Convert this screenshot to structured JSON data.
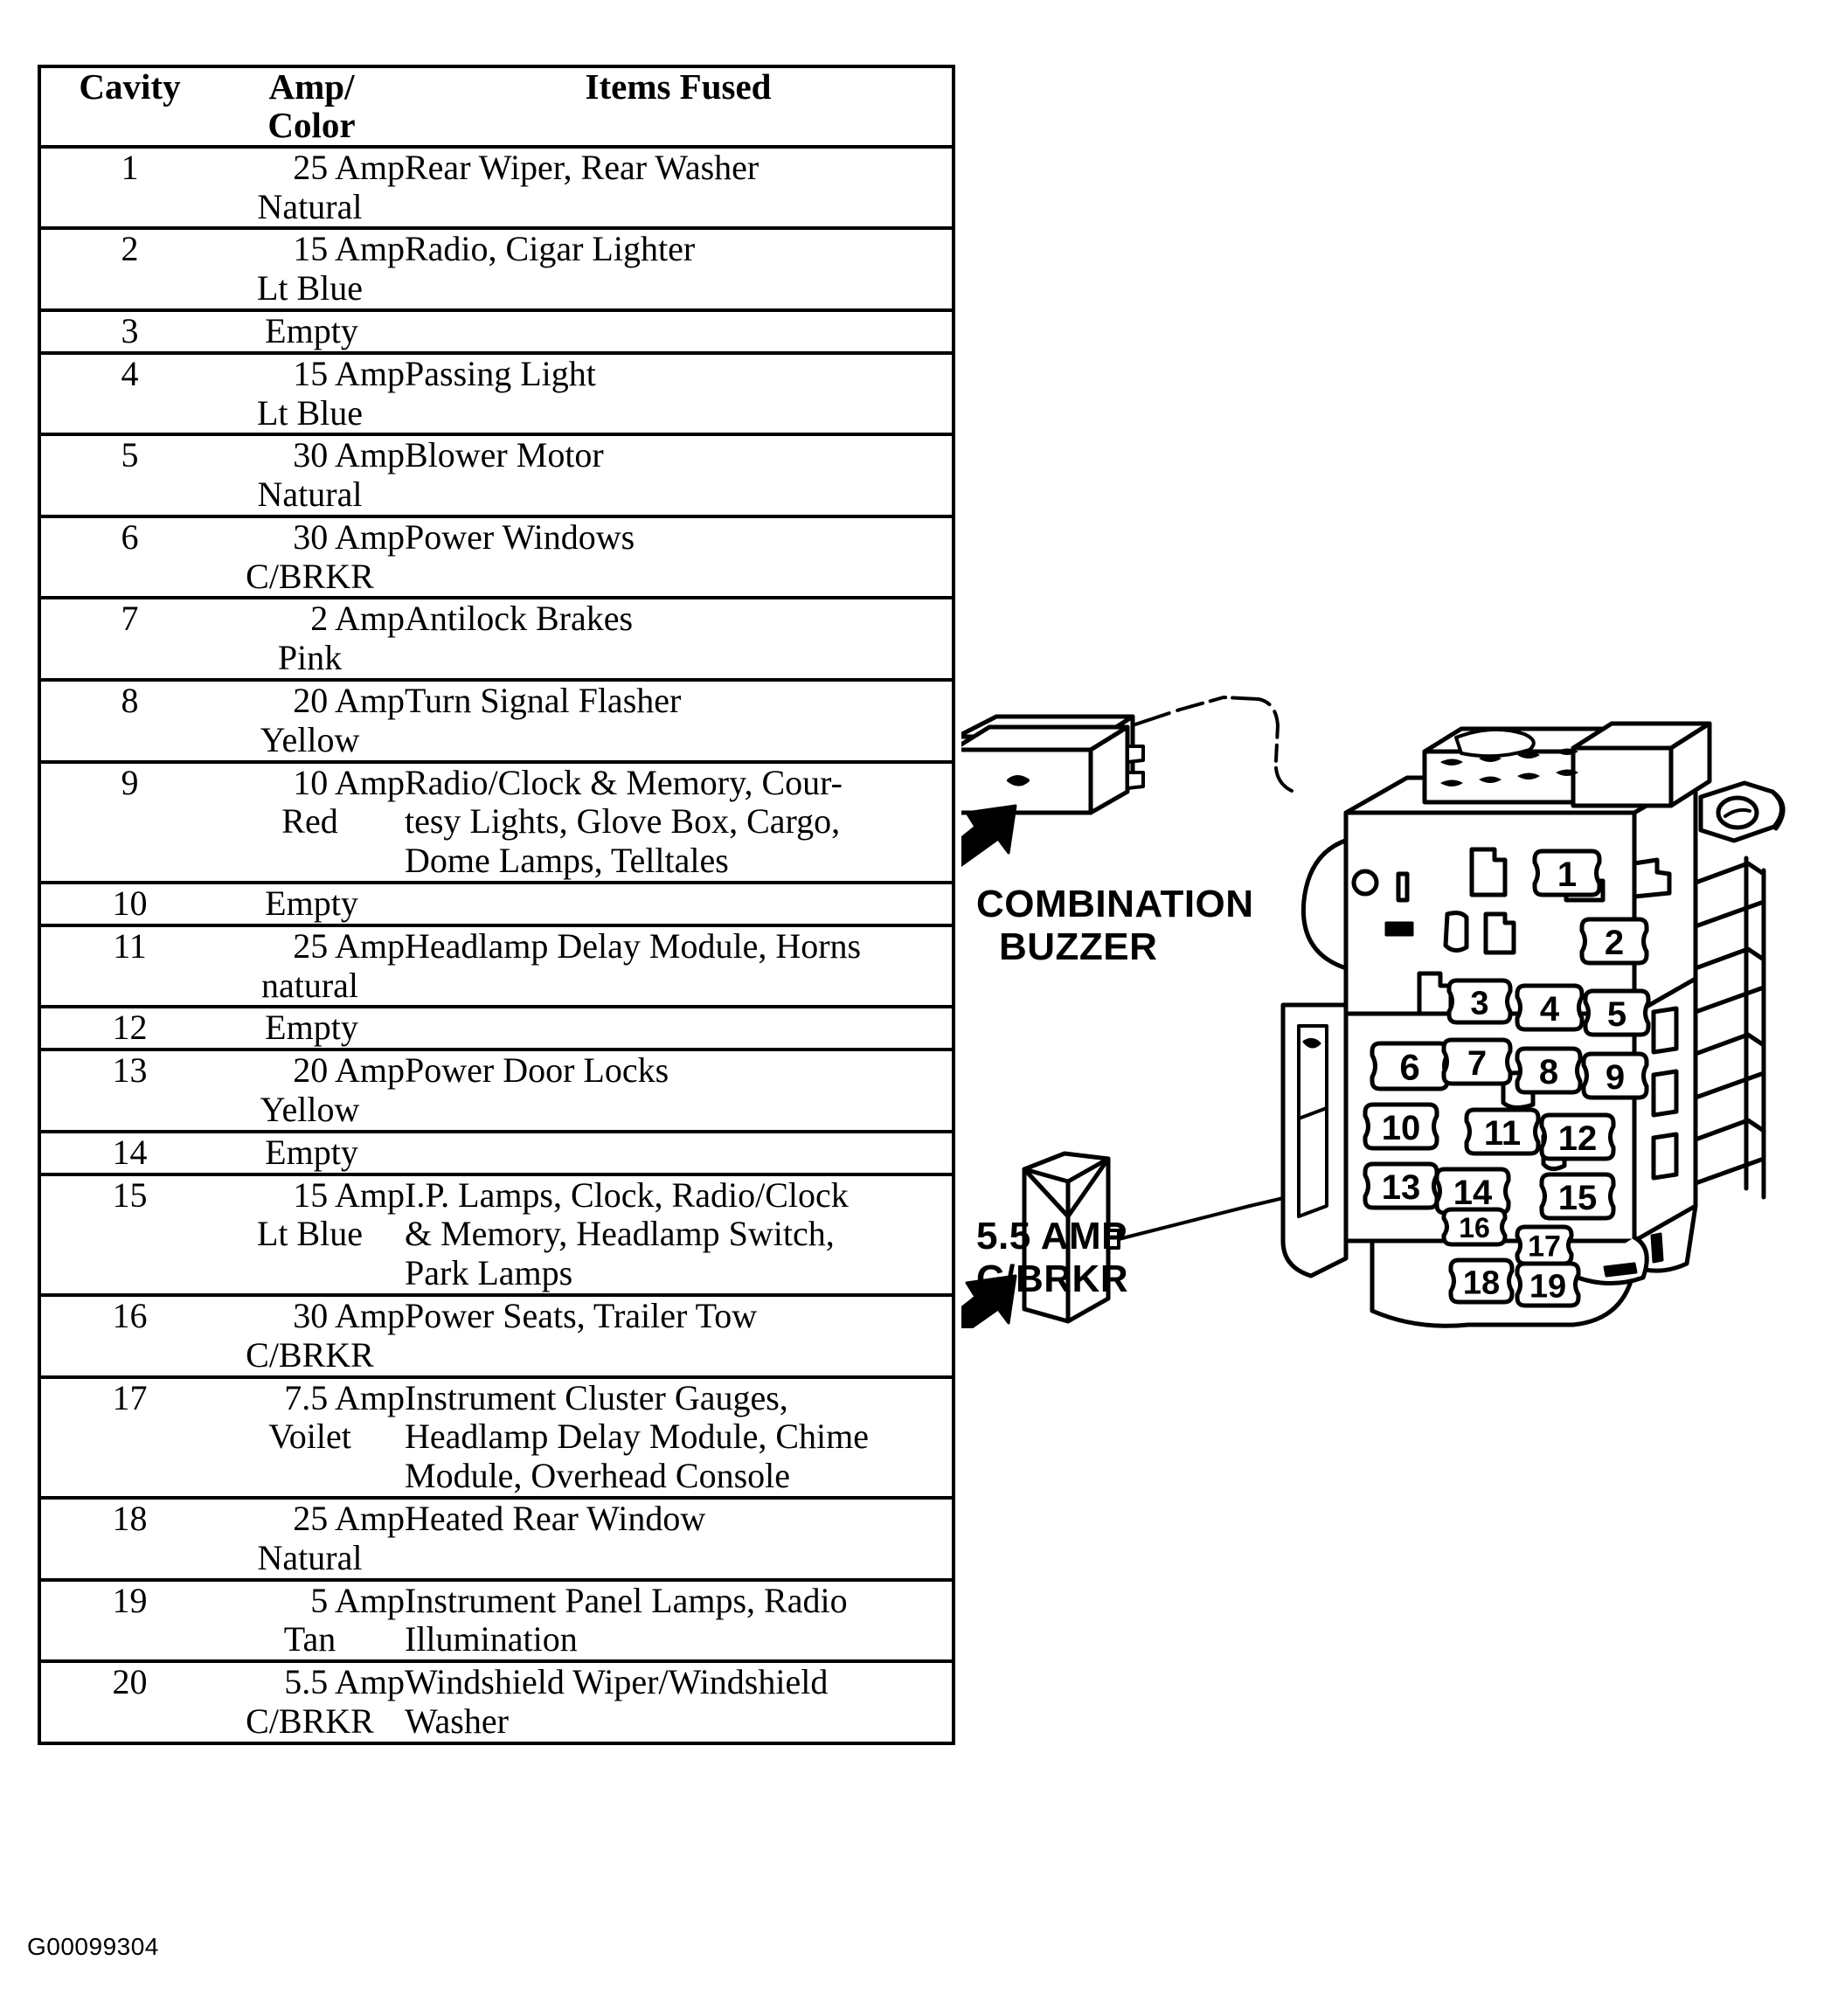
{
  "table": {
    "headers": {
      "cavity": "Cavity",
      "amp_line1": "Amp/",
      "amp_line2": "Color",
      "items": "Items Fused"
    },
    "rows": [
      {
        "cavity": "1",
        "amp": "25 Amp",
        "color": "Natural",
        "items": [
          "Rear Wiper, Rear Washer"
        ]
      },
      {
        "cavity": "2",
        "amp": "15 Amp",
        "color": "Lt Blue",
        "items": [
          "Radio, Cigar Lighter"
        ]
      },
      {
        "cavity": "3",
        "amp": "Empty",
        "color": "",
        "items": []
      },
      {
        "cavity": "4",
        "amp": "15 Amp",
        "color": "Lt Blue",
        "items": [
          "Passing Light"
        ]
      },
      {
        "cavity": "5",
        "amp": "30 Amp",
        "color": "Natural",
        "items": [
          "Blower Motor"
        ]
      },
      {
        "cavity": "6",
        "amp": "30 Amp",
        "color": "C/BRKR",
        "items": [
          "Power Windows"
        ]
      },
      {
        "cavity": "7",
        "amp": "2 Amp",
        "color": "Pink",
        "items": [
          "Antilock Brakes"
        ]
      },
      {
        "cavity": "8",
        "amp": "20 Amp",
        "color": "Yellow",
        "items": [
          "Turn Signal Flasher"
        ]
      },
      {
        "cavity": "9",
        "amp": "10 Amp",
        "color": "Red",
        "items": [
          "Radio/Clock & Memory, Cour-",
          "tesy Lights, Glove Box, Cargo,",
          "Dome Lamps, Telltales"
        ]
      },
      {
        "cavity": "10",
        "amp": "Empty",
        "color": "",
        "items": []
      },
      {
        "cavity": "11",
        "amp": "25 Amp",
        "color": "natural",
        "items": [
          "Headlamp Delay Module, Horns"
        ]
      },
      {
        "cavity": "12",
        "amp": "Empty",
        "color": "",
        "items": []
      },
      {
        "cavity": "13",
        "amp": "20 Amp",
        "color": "Yellow",
        "items": [
          "Power Door Locks"
        ]
      },
      {
        "cavity": "14",
        "amp": "Empty",
        "color": "",
        "items": []
      },
      {
        "cavity": "15",
        "amp": "15 Amp",
        "color": "Lt Blue",
        "items": [
          "I.P. Lamps, Clock, Radio/Clock",
          "& Memory, Headlamp Switch,",
          "Park Lamps"
        ]
      },
      {
        "cavity": "16",
        "amp": "30 Amp",
        "color": "C/BRKR",
        "items": [
          "Power Seats, Trailer Tow"
        ]
      },
      {
        "cavity": "17",
        "amp": "7.5 Amp",
        "color": "Voilet",
        "items": [
          "Instrument Cluster Gauges,",
          "Headlamp Delay Module, Chime",
          "Module, Overhead Console"
        ]
      },
      {
        "cavity": "18",
        "amp": "25 Amp",
        "color": "Natural",
        "items": [
          "Heated Rear Window"
        ]
      },
      {
        "cavity": "19",
        "amp": "5 Amp",
        "color": "Tan",
        "items": [
          "Instrument Panel Lamps, Radio",
          "Illumination"
        ]
      },
      {
        "cavity": "20",
        "amp": "5.5 Amp",
        "color": "C/BRKR",
        "items": [
          "Windshield Wiper/Windshield",
          "Washer"
        ]
      }
    ]
  },
  "diagram": {
    "callouts": {
      "combination_buzzer_line1": "COMBINATION",
      "combination_buzzer_line2": "BUZZER",
      "cbrkr_line1": "5.5 AMP",
      "cbrkr_line2": "C/BRKR"
    },
    "cavity_labels": [
      "1",
      "2",
      "3",
      "4",
      "5",
      "6",
      "7",
      "8",
      "9",
      "10",
      "11",
      "12",
      "13",
      "14",
      "15",
      "16",
      "17",
      "18",
      "19"
    ]
  },
  "footer": {
    "code": "G00099304"
  },
  "colors": {
    "ink": "#000000",
    "paper": "#ffffff"
  }
}
